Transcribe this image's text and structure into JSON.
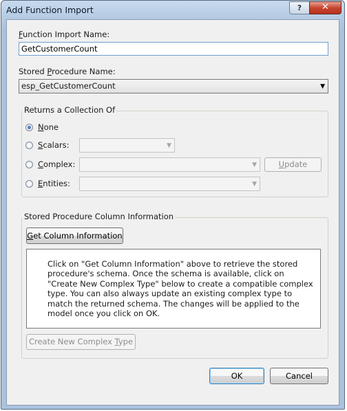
{
  "window": {
    "title": "Add Function Import",
    "help_glyph": "?",
    "close_glyph": "✕"
  },
  "function_import_name": {
    "label_mnemonic": "F",
    "label_rest": "unction Import Name:",
    "value": "GetCustomerCount"
  },
  "stored_procedure_name": {
    "label_before": "Stored ",
    "label_mnemonic": "P",
    "label_after": "rocedure Name:",
    "value": "esp_GetCustomerCount"
  },
  "returns_group": {
    "title": "Returns a Collection Of",
    "options": [
      {
        "mnemonic": "N",
        "rest": "one",
        "selected": true
      },
      {
        "mnemonic": "S",
        "rest": "calars:",
        "selected": false
      },
      {
        "mnemonic": "C",
        "rest": "omplex:",
        "selected": false
      },
      {
        "mnemonic": "E",
        "rest": "ntities:",
        "selected": false
      }
    ],
    "update_button": {
      "mnemonic": "U",
      "rest": "pdate"
    }
  },
  "column_info_group": {
    "title": "Stored Procedure Column Information",
    "get_column_button": {
      "mnemonic": "G",
      "rest": "et Column Information"
    },
    "info_text": "Click on \"Get Column Information\" above to retrieve the stored procedure's schema. Once the schema is available, click on \"Create New Complex Type\" below to create a compatible complex type. You can also always update an existing complex type to match the returned schema. The changes will be applied to the model once you click on OK.",
    "create_button": {
      "before": "Create New Complex ",
      "mnemonic": "T",
      "after": "ype"
    }
  },
  "footer": {
    "ok_label": "OK",
    "cancel_label": "Cancel"
  },
  "icons": {
    "dropdown_arrow": "▼"
  }
}
